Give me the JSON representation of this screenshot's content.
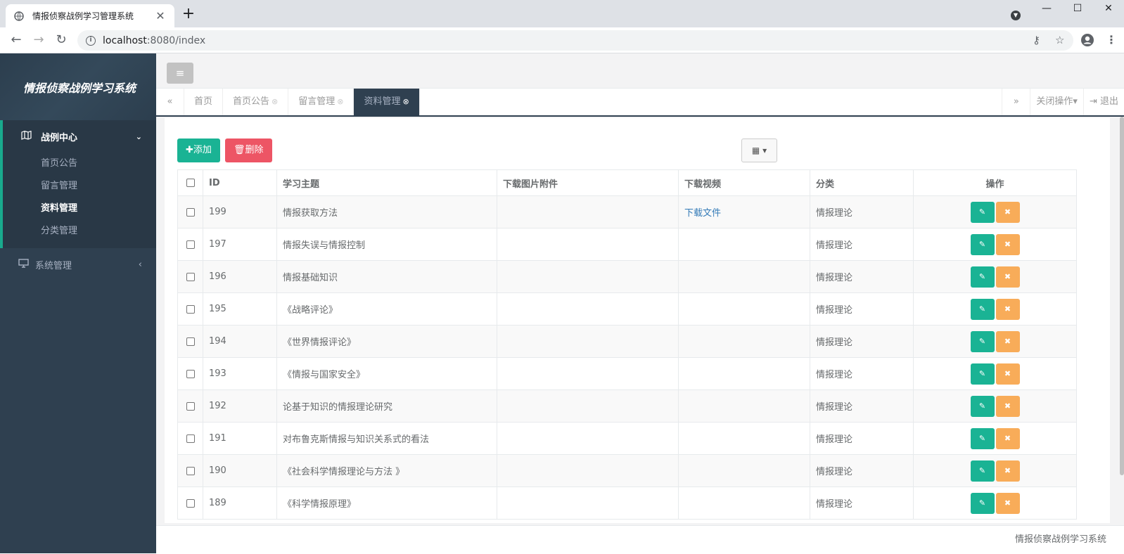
{
  "browser": {
    "tab_title": "情报侦察战例学习管理系统",
    "tab_close": "✕",
    "new_tab": "+",
    "url_host": "localhost",
    "url_rest": ":8080/index",
    "icons": [
      "globe-icon",
      "back-icon",
      "forward-icon",
      "reload-icon",
      "info-icon",
      "key-icon",
      "star-icon",
      "profile-icon",
      "more-icon",
      "minimize-icon",
      "maximize-icon",
      "close-icon"
    ]
  },
  "sidebar": {
    "logo": "情报侦察战例学习系统",
    "group1": {
      "label": "战例中心",
      "items": [
        {
          "label": "首页公告"
        },
        {
          "label": "留言管理"
        },
        {
          "label": "资料管理"
        },
        {
          "label": "分类管理"
        }
      ]
    },
    "group2": {
      "label": "系统管理"
    }
  },
  "tabs": {
    "items": [
      {
        "label": "首页"
      },
      {
        "label": "首页公告"
      },
      {
        "label": "留言管理"
      },
      {
        "label": "资料管理"
      }
    ],
    "close_ops": "关闭操作",
    "logout": "退出"
  },
  "toolbar": {
    "add_label": "添加",
    "delete_label": "删除"
  },
  "table": {
    "headers": {
      "id": "ID",
      "topic": "学习主题",
      "image": "下载图片附件",
      "video": "下载视频",
      "category": "分类",
      "ops": "操作"
    },
    "rows": [
      {
        "id": "199",
        "topic": "情报获取方法",
        "image": "",
        "video": "下载文件",
        "category": "情报理论"
      },
      {
        "id": "197",
        "topic": "情报失误与情报控制",
        "image": "",
        "video": "",
        "category": "情报理论"
      },
      {
        "id": "196",
        "topic": "情报基础知识",
        "image": "",
        "video": "",
        "category": "情报理论"
      },
      {
        "id": "195",
        "topic": "《战略评论》",
        "image": "",
        "video": "",
        "category": "情报理论"
      },
      {
        "id": "194",
        "topic": "《世界情报评论》",
        "image": "",
        "video": "",
        "category": "情报理论"
      },
      {
        "id": "193",
        "topic": "《情报与国家安全》",
        "image": "",
        "video": "",
        "category": "情报理论"
      },
      {
        "id": "192",
        "topic": "论基于知识的情报理论研究",
        "image": "",
        "video": "",
        "category": "情报理论"
      },
      {
        "id": "191",
        "topic": "对布鲁克斯情报与知识关系式的看法",
        "image": "",
        "video": "",
        "category": "情报理论"
      },
      {
        "id": "190",
        "topic": "《社会科学情报理论与方法 》",
        "image": "",
        "video": "",
        "category": "情报理论"
      },
      {
        "id": "189",
        "topic": "《科学情报原理》",
        "image": "",
        "video": "",
        "category": "情报理论"
      }
    ]
  },
  "footer": {
    "text": "情报侦察战例学习系统"
  },
  "colors": {
    "sidebar": "#2f4050",
    "primary": "#1ab394",
    "danger": "#ed5565",
    "warning": "#f8ac59",
    "link": "#337ab7"
  }
}
